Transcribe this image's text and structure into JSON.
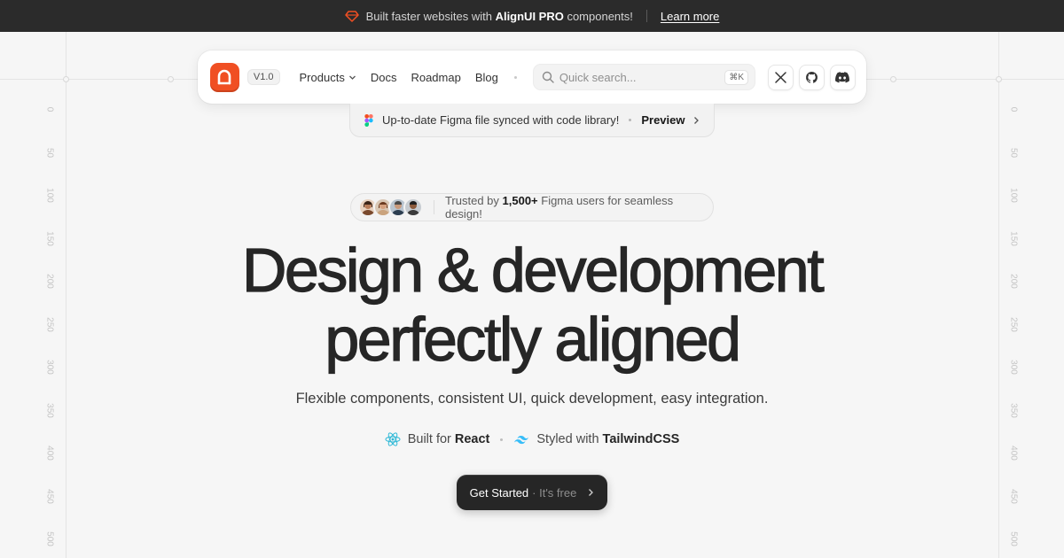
{
  "announcement": {
    "text_before": "Built faster websites with ",
    "text_bold": "AlignUI PRO",
    "text_after": " components!",
    "link": "Learn more",
    "accent": "#f04f23"
  },
  "nav": {
    "logo_color": "#f04f23",
    "version": "V1.0",
    "links": [
      "Products",
      "Docs",
      "Roadmap",
      "Blog"
    ],
    "search": {
      "placeholder": "Quick search...",
      "shortcut": "⌘K"
    },
    "social_icons": [
      "x-icon",
      "github-icon",
      "discord-icon"
    ]
  },
  "figma_banner": {
    "text": "Up-to-date Figma file synced with code library!",
    "action": "Preview"
  },
  "trust": {
    "prefix": "Trusted by ",
    "count": "1,500+",
    "suffix": " Figma users for seamless design!"
  },
  "hero": {
    "line1": "Design & development",
    "line2": "perfectly aligned",
    "subtitle": "Flexible components, consistent UI, quick development, easy integration."
  },
  "tech": {
    "react_prefix": "Built for ",
    "react_name": "React",
    "tailwind_prefix": "Styled with ",
    "tailwind_name": "TailwindCSS"
  },
  "cta": {
    "label": "Get Started",
    "note": "· It's free"
  },
  "rulers": [
    "0",
    "50",
    "100",
    "150",
    "200",
    "250",
    "300",
    "350",
    "400",
    "450",
    "500"
  ]
}
